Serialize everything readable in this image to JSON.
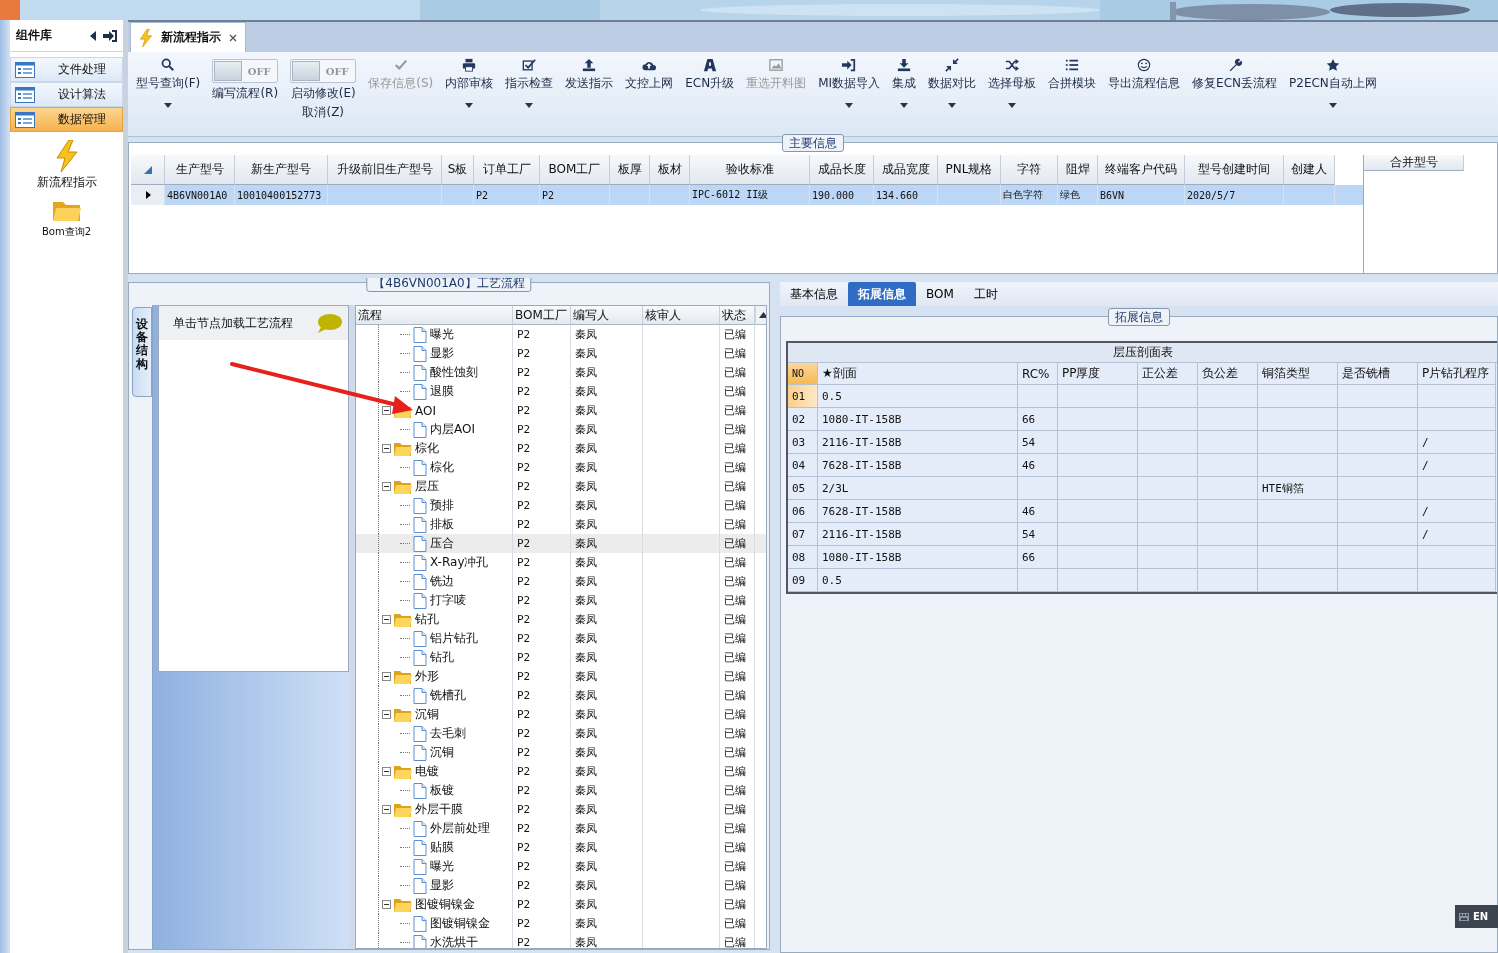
{
  "sidebar": {
    "title": "组件库",
    "items": [
      {
        "label": "文件处理",
        "selected": false
      },
      {
        "label": "设计算法",
        "selected": false
      },
      {
        "label": "数据管理",
        "selected": true
      }
    ],
    "shortcuts": [
      {
        "label": "新流程指示"
      },
      {
        "label": "Bom查询2"
      }
    ]
  },
  "document_tabs": [
    {
      "label": "新流程指示",
      "selected": true
    }
  ],
  "toolbar": [
    {
      "kind": "button",
      "label": "型号查询(F)",
      "disabled": false,
      "menu": true
    },
    {
      "kind": "toggle",
      "lines": [
        "编写流程(R)"
      ],
      "switch_text": "OFF",
      "on": false
    },
    {
      "kind": "toggle",
      "lines": [
        "启动修改(E)",
        "取消(Z)"
      ],
      "switch_text": "OFF",
      "on": false
    },
    {
      "kind": "button",
      "label": "保存信息(S)",
      "disabled": true,
      "menu": false
    },
    {
      "kind": "button",
      "label": "内部审核",
      "disabled": false,
      "menu": true
    },
    {
      "kind": "button",
      "label": "指示检查",
      "disabled": false,
      "menu": true
    },
    {
      "kind": "button",
      "label": "发送指示",
      "disabled": false,
      "menu": false
    },
    {
      "kind": "button",
      "label": "文控上网",
      "disabled": false,
      "menu": false
    },
    {
      "kind": "button",
      "label": "ECN升级",
      "disabled": false,
      "menu": false
    },
    {
      "kind": "button",
      "label": "重选开料图",
      "disabled": true,
      "menu": false
    },
    {
      "kind": "button",
      "label": "MI数据导入",
      "disabled": false,
      "menu": true
    },
    {
      "kind": "button",
      "label": "集成",
      "disabled": false,
      "menu": true
    },
    {
      "kind": "button",
      "label": "数据对比",
      "disabled": false,
      "menu": true
    },
    {
      "kind": "button",
      "label": "选择母板",
      "disabled": false,
      "menu": true
    },
    {
      "kind": "button",
      "label": "合拼模块",
      "disabled": false,
      "menu": false
    },
    {
      "kind": "button",
      "label": "导出流程信息",
      "disabled": false,
      "menu": false
    },
    {
      "kind": "button",
      "label": "修复ECN丢流程",
      "disabled": false,
      "menu": false
    },
    {
      "kind": "button",
      "label": "P2ECN自动上网",
      "disabled": false,
      "menu": true
    }
  ],
  "main_info": {
    "title": "主要信息",
    "columns": [
      "生产型号",
      "新生产型号",
      "升级前旧生产型号",
      "S板",
      "订单工厂",
      "BOM工厂",
      "板厚",
      "板材",
      "验收标准",
      "成品长度",
      "成品宽度",
      "PNL规格",
      "字符",
      "阻焊",
      "终端客户代码",
      "型号创建时间",
      "创建人"
    ],
    "rows": [
      {
        "selected": true,
        "cells": [
          "4B6VN001A0",
          "10010400152773",
          null,
          null,
          "P2",
          "P2",
          null,
          null,
          "IPC-6012 II级",
          "190.000",
          "134.660",
          null,
          "白色字符",
          "绿色",
          "B6VN",
          "2020/5/7",
          null
        ]
      }
    ],
    "side_columns": [
      "合并型号"
    ]
  },
  "process": {
    "title": "【4B6VN001A0】工艺流程",
    "side_tab": "设备结构",
    "hint": "单击节点加载工艺流程",
    "columns": [
      "流程",
      "BOM工厂",
      "编写人",
      "核审人",
      "状态"
    ],
    "tree": [
      {
        "children": [
          {
            "label": "曝光",
            "bom_factory": "P2",
            "writer": "秦凤",
            "status": "已编",
            "selected": false
          },
          {
            "label": "显影",
            "bom_factory": "P2",
            "writer": "秦凤",
            "status": "已编",
            "selected": false
          },
          {
            "label": "酸性蚀刻",
            "bom_factory": "P2",
            "writer": "秦凤",
            "status": "已编",
            "selected": false
          },
          {
            "label": "退膜",
            "bom_factory": "P2",
            "writer": "秦凤",
            "status": "已编",
            "selected": false
          }
        ]
      },
      {
        "label": "AOI",
        "bom_factory": "P2",
        "writer": "秦凤",
        "status": "已编",
        "selected": false,
        "expanded": true,
        "children": [
          {
            "label": "内层AOI",
            "bom_factory": "P2",
            "writer": "秦凤",
            "status": "已编",
            "selected": false
          }
        ]
      },
      {
        "label": "棕化",
        "bom_factory": "P2",
        "writer": "秦凤",
        "status": "已编",
        "selected": false,
        "expanded": true,
        "children": [
          {
            "label": "棕化",
            "bom_factory": "P2",
            "writer": "秦凤",
            "status": "已编",
            "selected": false
          }
        ]
      },
      {
        "label": "层压",
        "bom_factory": "P2",
        "writer": "秦凤",
        "status": "已编",
        "selected": false,
        "expanded": true,
        "children": [
          {
            "label": "预排",
            "bom_factory": "P2",
            "writer": "秦凤",
            "status": "已编",
            "selected": false
          },
          {
            "label": "排板",
            "bom_factory": "P2",
            "writer": "秦凤",
            "status": "已编",
            "selected": false
          },
          {
            "label": "压合",
            "bom_factory": "P2",
            "writer": "秦凤",
            "status": "已编",
            "selected": true
          },
          {
            "label": "X-Ray冲孔",
            "bom_factory": "P2",
            "writer": "秦凤",
            "status": "已编",
            "selected": false
          },
          {
            "label": "铣边",
            "bom_factory": "P2",
            "writer": "秦凤",
            "status": "已编",
            "selected": false
          },
          {
            "label": "打字唛",
            "bom_factory": "P2",
            "writer": "秦凤",
            "status": "已编",
            "selected": false
          }
        ]
      },
      {
        "label": "钻孔",
        "bom_factory": "P2",
        "writer": "秦凤",
        "status": "已编",
        "selected": false,
        "expanded": true,
        "children": [
          {
            "label": "铝片钻孔",
            "bom_factory": "P2",
            "writer": "秦凤",
            "status": "已编",
            "selected": false
          },
          {
            "label": "钻孔",
            "bom_factory": "P2",
            "writer": "秦凤",
            "status": "已编",
            "selected": false
          }
        ]
      },
      {
        "label": "外形",
        "bom_factory": "P2",
        "writer": "秦凤",
        "status": "已编",
        "selected": false,
        "expanded": true,
        "children": [
          {
            "label": "铣槽孔",
            "bom_factory": "P2",
            "writer": "秦凤",
            "status": "已编",
            "selected": false
          }
        ]
      },
      {
        "label": "沉铜",
        "bom_factory": "P2",
        "writer": "秦凤",
        "status": "已编",
        "selected": false,
        "expanded": true,
        "children": [
          {
            "label": "去毛刺",
            "bom_factory": "P2",
            "writer": "秦凤",
            "status": "已编",
            "selected": false
          },
          {
            "label": "沉铜",
            "bom_factory": "P2",
            "writer": "秦凤",
            "status": "已编",
            "selected": false
          }
        ]
      },
      {
        "label": "电镀",
        "bom_factory": "P2",
        "writer": "秦凤",
        "status": "已编",
        "selected": false,
        "expanded": true,
        "children": [
          {
            "label": "板镀",
            "bom_factory": "P2",
            "writer": "秦凤",
            "status": "已编",
            "selected": false
          }
        ]
      },
      {
        "label": "外层干膜",
        "bom_factory": "P2",
        "writer": "秦凤",
        "status": "已编",
        "selected": false,
        "expanded": true,
        "children": [
          {
            "label": "外层前处理",
            "bom_factory": "P2",
            "writer": "秦凤",
            "status": "已编",
            "selected": false
          },
          {
            "label": "贴膜",
            "bom_factory": "P2",
            "writer": "秦凤",
            "status": "已编",
            "selected": false
          },
          {
            "label": "曝光",
            "bom_factory": "P2",
            "writer": "秦凤",
            "status": "已编",
            "selected": false
          },
          {
            "label": "显影",
            "bom_factory": "P2",
            "writer": "秦凤",
            "status": "已编",
            "selected": false
          }
        ]
      },
      {
        "label": "图镀铜镍金",
        "bom_factory": "P2",
        "writer": "秦凤",
        "status": "已编",
        "selected": false,
        "expanded": true,
        "children": [
          {
            "label": "图镀铜镍金",
            "bom_factory": "P2",
            "writer": "秦凤",
            "status": "已编",
            "selected": false
          },
          {
            "label": "水洗烘干",
            "bom_factory": "P2",
            "writer": "秦凤",
            "status": "已编",
            "selected": false
          }
        ]
      }
    ]
  },
  "detail_tabs": [
    {
      "label": "基本信息",
      "selected": false
    },
    {
      "label": "拓展信息",
      "selected": true
    },
    {
      "label": "BOM",
      "selected": false
    },
    {
      "label": "工时",
      "selected": false
    }
  ],
  "extension": {
    "title": "拓展信息",
    "table_title": "层压剖面表",
    "columns": [
      "NO",
      "★剖面",
      "RC%",
      "PP厚度",
      "正公差",
      "负公差",
      "铜箔类型",
      "是否铣槽",
      "P片钻孔程序"
    ],
    "rows": [
      {
        "selected": true,
        "cells": [
          "01",
          "0.5",
          null,
          null,
          null,
          null,
          null,
          null,
          null
        ]
      },
      {
        "selected": false,
        "cells": [
          "02",
          "1080-IT-158B",
          "66",
          null,
          null,
          null,
          null,
          null,
          null
        ]
      },
      {
        "selected": false,
        "cells": [
          "03",
          "2116-IT-158B",
          "54",
          null,
          null,
          null,
          null,
          null,
          "/"
        ]
      },
      {
        "selected": false,
        "cells": [
          "04",
          "7628-IT-158B",
          "46",
          null,
          null,
          null,
          null,
          null,
          "/"
        ]
      },
      {
        "selected": false,
        "cells": [
          "05",
          "2/3L",
          null,
          null,
          null,
          null,
          "HTE铜箔",
          null,
          null
        ]
      },
      {
        "selected": false,
        "cells": [
          "06",
          "7628-IT-158B",
          "46",
          null,
          null,
          null,
          null,
          null,
          "/"
        ]
      },
      {
        "selected": false,
        "cells": [
          "07",
          "2116-IT-158B",
          "54",
          null,
          null,
          null,
          null,
          null,
          "/"
        ]
      },
      {
        "selected": false,
        "cells": [
          "08",
          "1080-IT-158B",
          "66",
          null,
          null,
          null,
          null,
          null,
          null
        ]
      },
      {
        "selected": false,
        "cells": [
          "09",
          "0.5",
          null,
          null,
          null,
          null,
          null,
          null,
          null
        ]
      }
    ]
  },
  "input_indicator": "EN",
  "annotations": [
    {
      "kind": "arrow"
    }
  ]
}
